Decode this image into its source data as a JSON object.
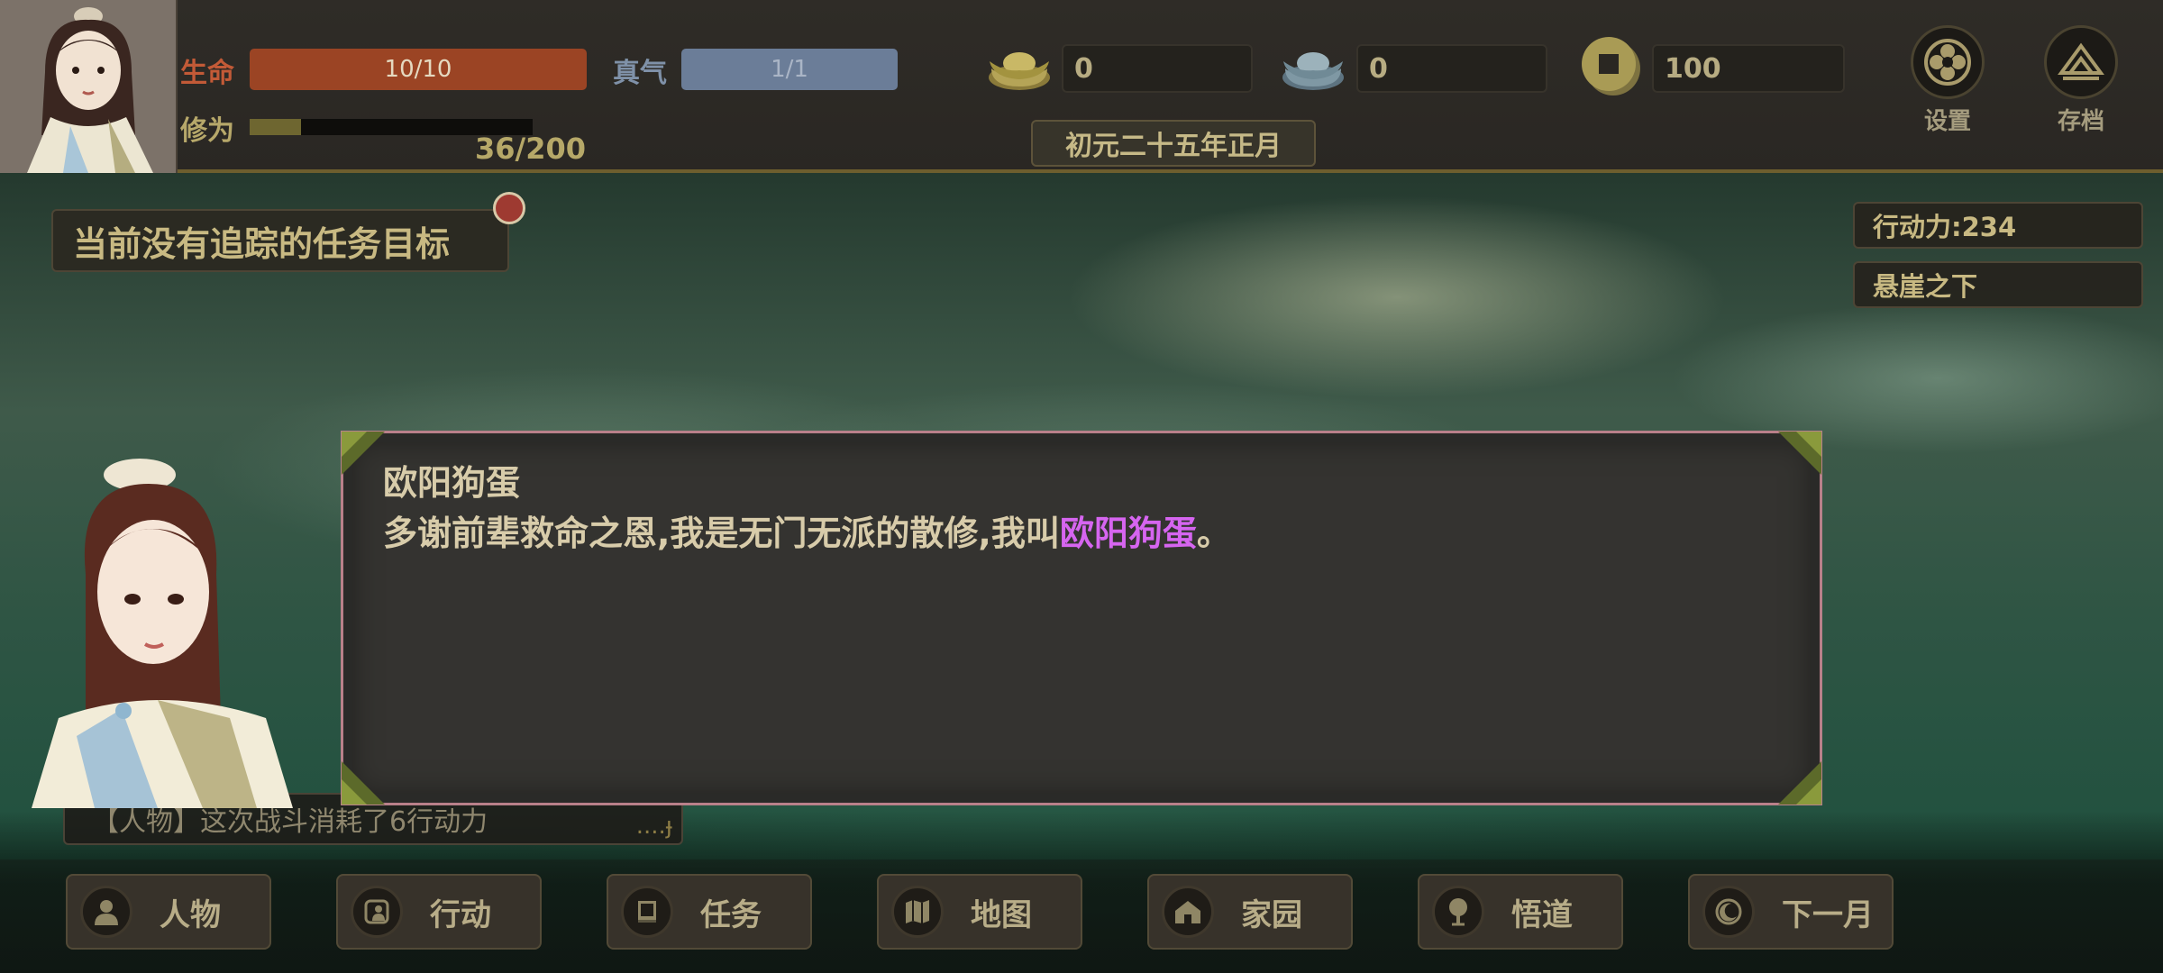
{
  "player": {
    "hp_label": "生命",
    "hp_value": "10/10",
    "hp_fraction": 1.0,
    "qi_label": "真气",
    "qi_value": "1/1",
    "qi_fraction": 1.0,
    "xp_label": "修为",
    "xp_value": "36/200",
    "xp_fraction": 0.18
  },
  "currencies": [
    {
      "icon": "gold-ingot-icon",
      "value": "0"
    },
    {
      "icon": "silver-ingot-icon",
      "value": "0"
    },
    {
      "icon": "copper-coin-icon",
      "value": "100"
    }
  ],
  "date": "初元二十五年正月",
  "system_buttons": {
    "settings_label": "设置",
    "save_label": "存档"
  },
  "quest_tracker": "当前没有追踪的任务目标",
  "right_info": {
    "action_points": "行动力:234",
    "location": "悬崖之下"
  },
  "log": {
    "line": "【人物】这次战斗消耗了6行动力"
  },
  "dialog": {
    "speaker": "欧阳狗蛋",
    "text_before": "多谢前辈救命之恩,我是无门无派的散修,我叫",
    "text_highlight": "欧阳狗蛋",
    "text_after": "。"
  },
  "nav": [
    {
      "label": "人物",
      "icon": "person-icon"
    },
    {
      "label": "行动",
      "icon": "action-icon"
    },
    {
      "label": "任务",
      "icon": "book-icon"
    },
    {
      "label": "地图",
      "icon": "map-icon"
    },
    {
      "label": "家园",
      "icon": "home-icon"
    },
    {
      "label": "悟道",
      "icon": "tree-icon"
    },
    {
      "label": "下一月",
      "icon": "moon-icon"
    }
  ],
  "colors": {
    "hp_bar": "#9b4424",
    "qi_bar": "#6b7d98",
    "highlight_name": "#d665f0",
    "dialog_border": "#b9808a"
  }
}
